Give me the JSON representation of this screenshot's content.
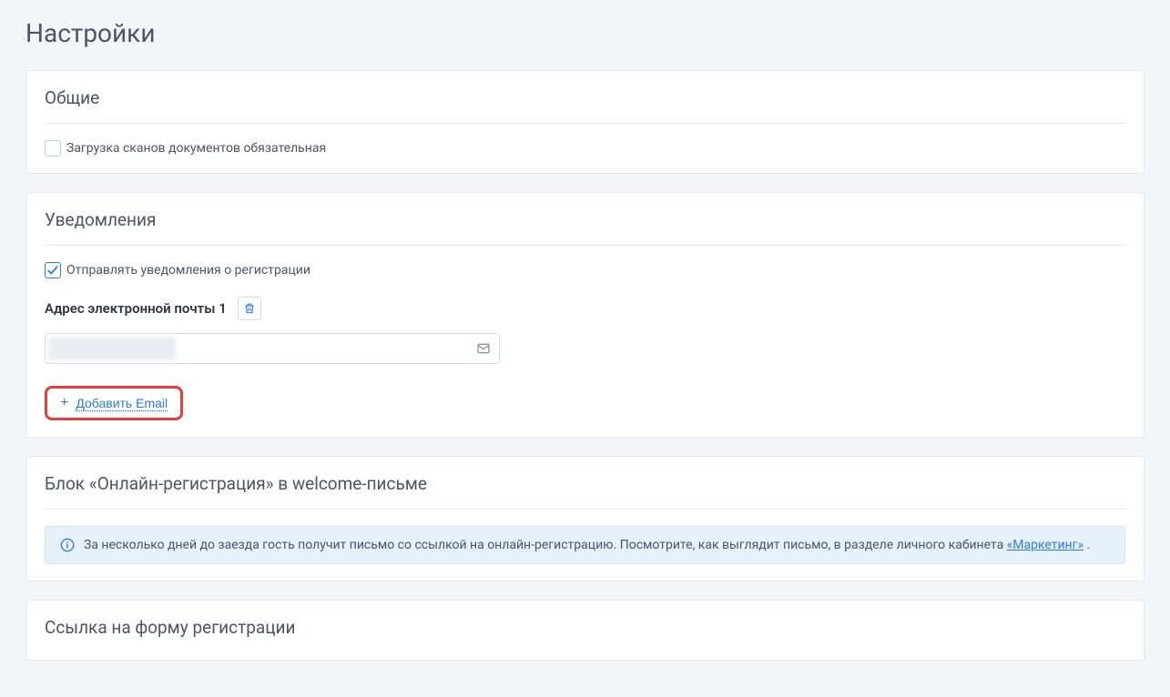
{
  "page": {
    "title": "Настройки"
  },
  "sections": {
    "general": {
      "title": "Общие",
      "uploadScansRequired": {
        "label": "Загрузка сканов документов обязательная",
        "checked": false
      }
    },
    "notifications": {
      "title": "Уведомления",
      "sendRegistrationNotifications": {
        "label": "Отправлять уведомления о регистрации",
        "checked": true
      },
      "emailFieldLabel": "Адрес электронной почты 1",
      "emailValue": "",
      "addEmailLabel": "Добавить Email"
    },
    "welcomeBlock": {
      "title": "Блок «Онлайн-регистрация» в welcome-письме",
      "infoText": "За несколько дней до заезда гость получит письмо со ссылкой на онлайн-регистрацию. Посмотрите, как выглядит письмо, в разделе личного кабинета ",
      "infoLink": "«Маркетинг»",
      "infoSuffix": " ."
    },
    "registrationLink": {
      "title": "Ссылка на форму регистрации"
    }
  }
}
